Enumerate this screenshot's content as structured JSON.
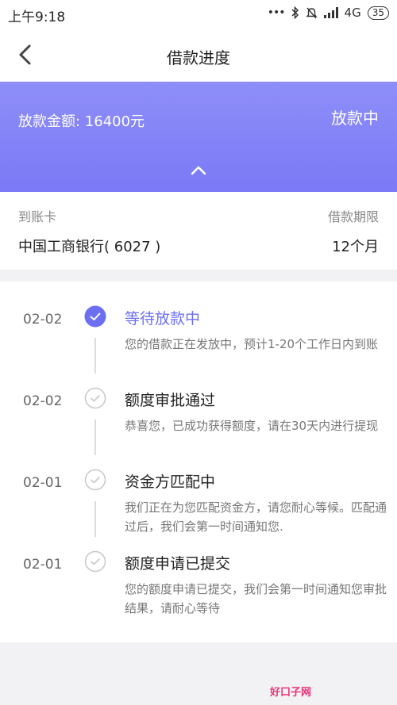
{
  "status_bar": {
    "time": "上午9:18",
    "dots": "•••",
    "network": "4G",
    "battery": "35"
  },
  "header": {
    "title": "借款进度"
  },
  "banner": {
    "amount_text": "放款金额: 16400元",
    "status_text": "放款中"
  },
  "card_info": {
    "card_label": "到账卡",
    "term_label": "借款期限",
    "card_value": "中国工商银行( 6027 )",
    "term_value": "12个月"
  },
  "timeline": {
    "items": [
      {
        "date": "02-02",
        "title": "等待放款中",
        "desc": "您的借款正在发放中，预计1-20个工作日内到账",
        "state": "active"
      },
      {
        "date": "02-02",
        "title": "额度审批通过",
        "desc": "恭喜您，已成功获得额度，请在30天内进行提现",
        "state": "done"
      },
      {
        "date": "02-01",
        "title": "资金方匹配中",
        "desc": "我们正在为您匹配资金方，请您耐心等候。匹配通过后，我们会第一时间通知您.",
        "state": "done"
      },
      {
        "date": "02-01",
        "title": "额度申请已提交",
        "desc": "您的额度申请已提交，我们会第一时间通知您审批结果，请耐心等待",
        "state": "done"
      }
    ]
  },
  "watermark": {
    "text": "好口子网"
  },
  "colors": {
    "accent": "#6d6ff3",
    "banner_start": "#8e8ef8",
    "banner_end": "#7b79f6"
  }
}
